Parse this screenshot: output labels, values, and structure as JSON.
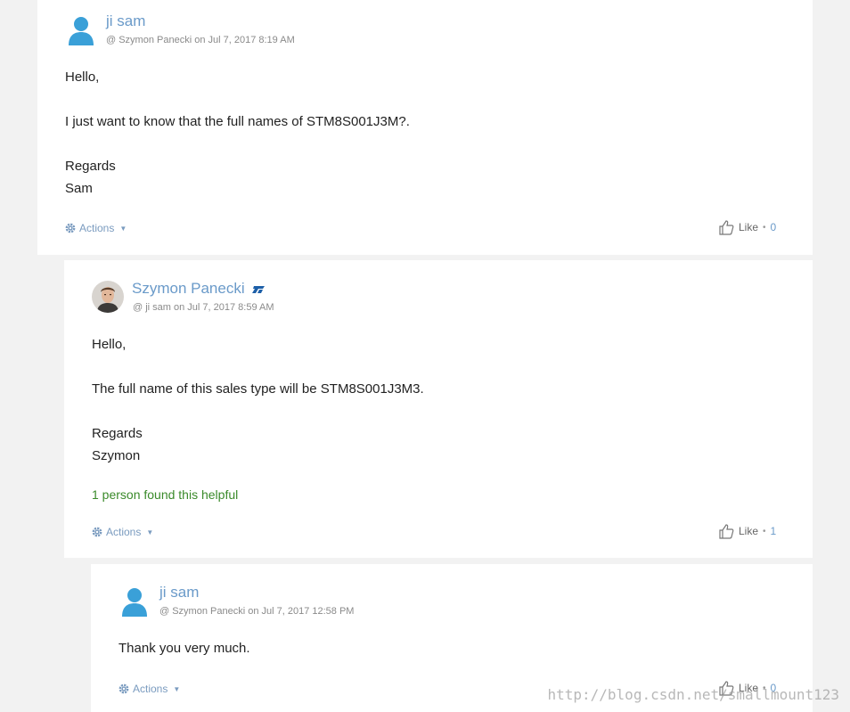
{
  "posts": [
    {
      "author": "ji sam",
      "meta": "@ Szymon Panecki on Jul 7, 2017 8:19 AM",
      "body": [
        "Hello,",
        "",
        "I just want to know that the full names of STM8S001J3M?.",
        "",
        "Regards",
        "Sam"
      ],
      "actions_label": "Actions",
      "like_label": "Like",
      "like_count": "0"
    },
    {
      "author": "Szymon Panecki",
      "meta": "@ ji sam on Jul 7, 2017 8:59 AM",
      "body": [
        "Hello,",
        "",
        "The full name of this sales type will be STM8S001J3M3.",
        "",
        "Regards",
        "Szymon"
      ],
      "helpful": "1 person found this helpful",
      "actions_label": "Actions",
      "like_label": "Like",
      "like_count": "1"
    },
    {
      "author": "ji sam",
      "meta": "@ Szymon Panecki on Jul 7, 2017 12:58 PM",
      "body": [
        "Thank you very much."
      ],
      "actions_label": "Actions",
      "like_label": "Like",
      "like_count": "0"
    }
  ],
  "watermark": "http://blog.csdn.net/smallmount123",
  "icons": {
    "default_avatar": "user-silhouette-icon",
    "photo_avatar": "user-photo-avatar",
    "company_badge": "st-logo-icon",
    "actions": "gear-icon",
    "dropdown": "caret-down-icon",
    "like": "thumbs-up-icon"
  },
  "colors": {
    "link": "#6a9ac9",
    "helpful": "#3a8a2a",
    "avatar_blue": "#3aa0d8"
  }
}
